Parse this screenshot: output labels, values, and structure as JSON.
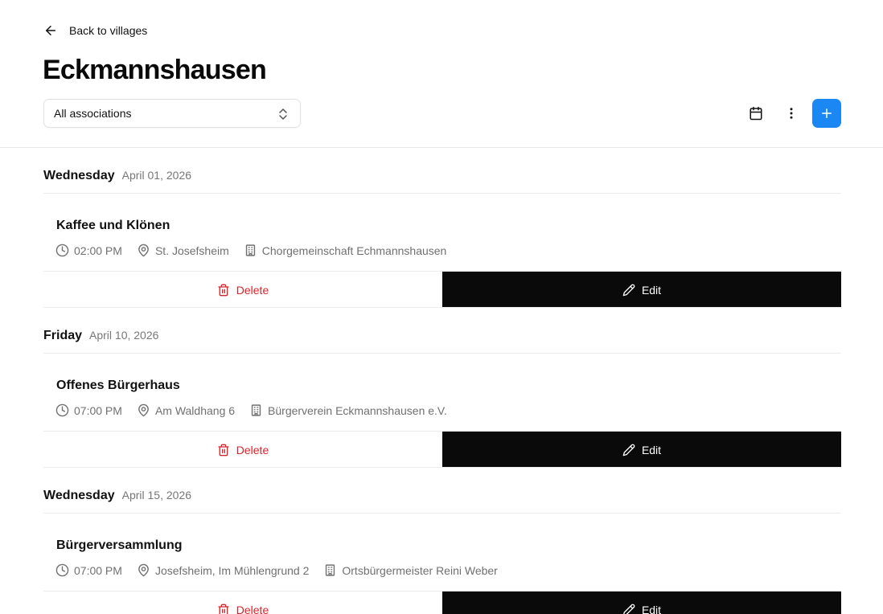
{
  "header": {
    "back_label": "Back to villages",
    "title": "Eckmannshausen",
    "filter": {
      "selected": "All associations"
    }
  },
  "colors": {
    "accent": "#1b87f3",
    "danger": "#d8232a",
    "dark": "#0a0a0a"
  },
  "icons": {
    "back": "arrow-left-icon",
    "calendar": "calendar-icon",
    "more": "more-vertical-icon",
    "add": "plus-icon",
    "time": "clock-icon",
    "location": "map-pin-icon",
    "organizer": "building-icon",
    "delete": "trash-icon",
    "edit": "pencil-icon"
  },
  "actions": {
    "delete_label": "Delete",
    "edit_label": "Edit"
  },
  "days": [
    {
      "weekday": "Wednesday",
      "date": "April 01, 2026",
      "event": {
        "title": "Kaffee und Klönen",
        "time": "02:00 PM",
        "location": "St. Josefsheim",
        "organizer": "Chorgemeinschaft Echmannshausen"
      }
    },
    {
      "weekday": "Friday",
      "date": "April 10, 2026",
      "event": {
        "title": "Offenes Bürgerhaus",
        "time": "07:00 PM",
        "location": "Am Waldhang 6",
        "organizer": "Bürgerverein Eckmannshausen e.V."
      }
    },
    {
      "weekday": "Wednesday",
      "date": "April 15, 2026",
      "event": {
        "title": "Bürgerversammlung",
        "time": "07:00 PM",
        "location": "Josefsheim, Im Mühlengrund 2",
        "organizer": "Ortsbürgermeister Reini Weber"
      }
    }
  ]
}
